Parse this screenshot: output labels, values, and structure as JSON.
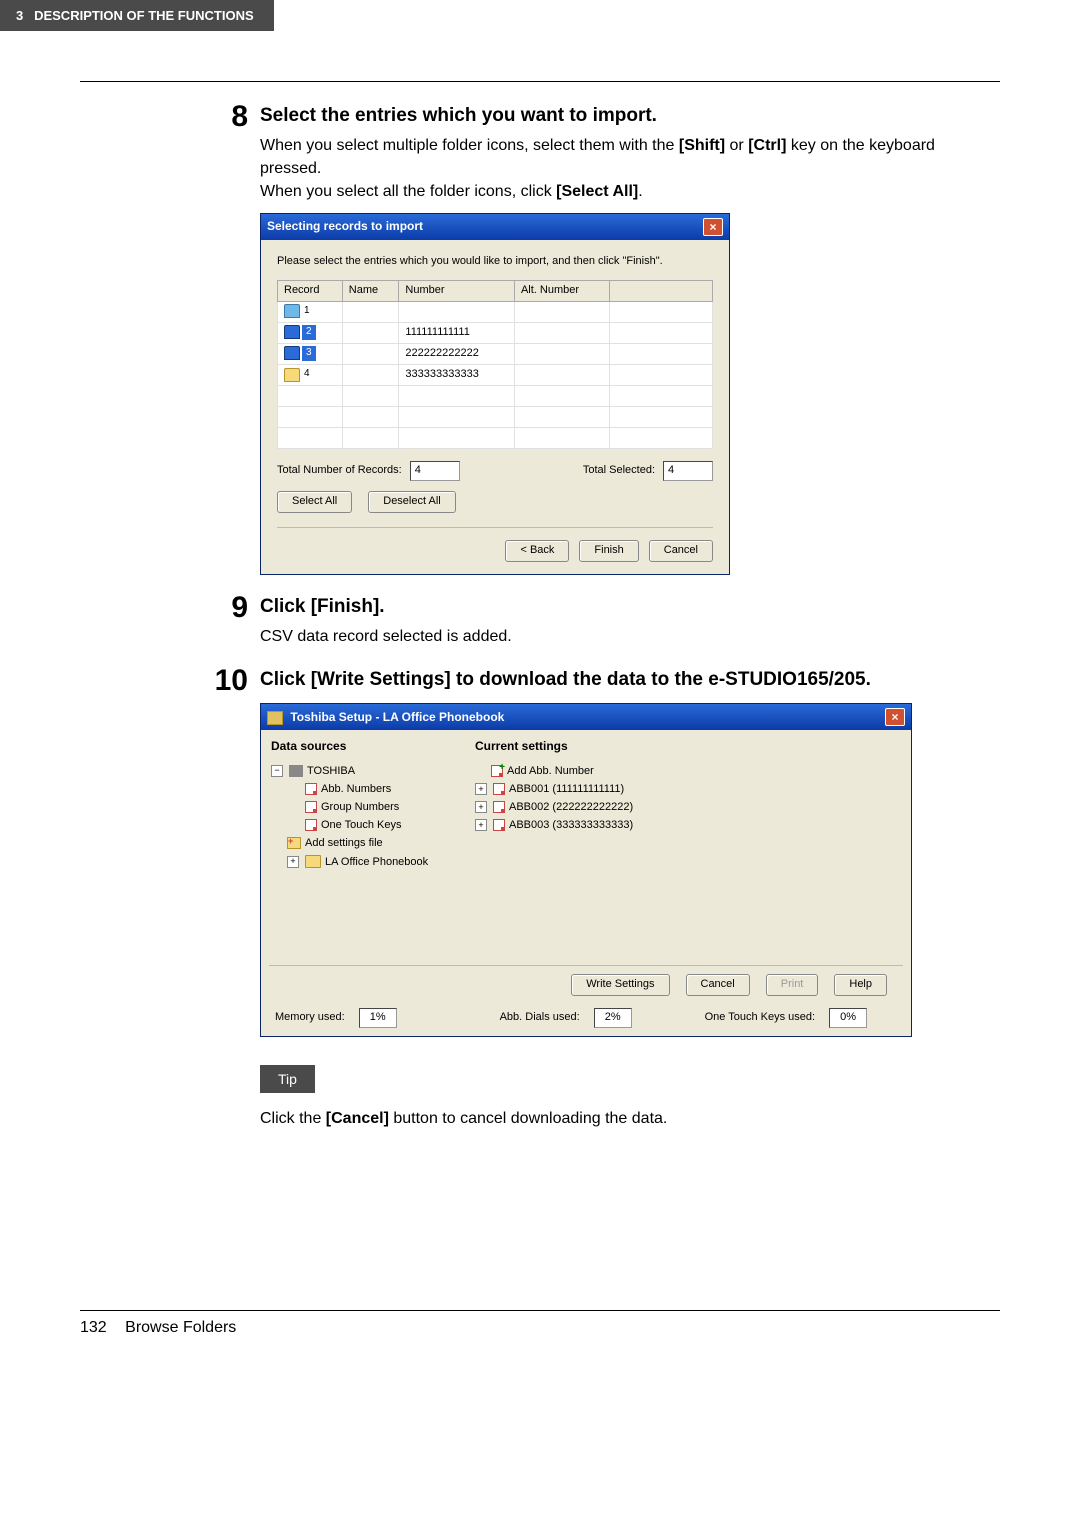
{
  "header": {
    "section": "3",
    "title": "DESCRIPTION OF THE FUNCTIONS"
  },
  "step8": {
    "num": "8",
    "title": "Select the entries which you want to import.",
    "text_a": "When you select multiple folder icons, select them with the ",
    "bold_shift": "[Shift]",
    "mid": " or ",
    "bold_ctrl": "[Ctrl]",
    "text_b": " key on the keyboard pressed.",
    "line2a": "When you select all the folder icons, click ",
    "bold_selectall": "[Select All]",
    "line2b": "."
  },
  "dlg1": {
    "title": "Selecting records to import",
    "instruction": "Please select the entries which you would like to import, and then click \"Finish\".",
    "cols": {
      "record": "Record",
      "name": "Name",
      "number": "Number",
      "alt": "Alt. Number"
    },
    "rows": [
      {
        "idx": "1",
        "sel": false,
        "number": ""
      },
      {
        "idx": "2",
        "sel": true,
        "number": "111111111111"
      },
      {
        "idx": "3",
        "sel": true,
        "number": "222222222222"
      },
      {
        "idx": "4",
        "sel": false,
        "number": "333333333333",
        "yel": true
      }
    ],
    "total_records_label": "Total Number of Records:",
    "total_records": "4",
    "total_selected_label": "Total Selected:",
    "total_selected": "4",
    "select_all": "Select All",
    "deselect_all": "Deselect All",
    "back": "< Back",
    "finish": "Finish",
    "cancel": "Cancel"
  },
  "step9": {
    "num": "9",
    "title": "Click [Finish].",
    "text": "CSV data record selected is added."
  },
  "step10": {
    "num": "10",
    "title": "Click [Write Settings] to download the data to the e-STUDIO165/205."
  },
  "dlg2": {
    "title": "Toshiba Setup - LA Office Phonebook",
    "left_head": "Data sources",
    "right_head": "Current settings",
    "src": {
      "root": "TOSHIBA",
      "abb": "Abb. Numbers",
      "group": "Group Numbers",
      "otk": "One Touch Keys",
      "add": "Add settings file",
      "la": "LA Office Phonebook"
    },
    "cur": {
      "add": "Add Abb. Number",
      "e1": "ABB001 (111111111111)",
      "e2": "ABB002 (222222222222)",
      "e3": "ABB003 (333333333333)"
    },
    "btns": {
      "write": "Write Settings",
      "cancel": "Cancel",
      "print": "Print",
      "help": "Help"
    },
    "status": {
      "mem_label": "Memory used:",
      "mem": "1%",
      "dials_label": "Abb. Dials used:",
      "dials": "2%",
      "otk_label": "One Touch Keys used:",
      "otk": "0%"
    }
  },
  "tip": {
    "badge": "Tip",
    "a": "Click the ",
    "b": "[Cancel]",
    "c": " button to cancel downloading the data."
  },
  "footer": {
    "page": "132",
    "label": "Browse Folders"
  }
}
